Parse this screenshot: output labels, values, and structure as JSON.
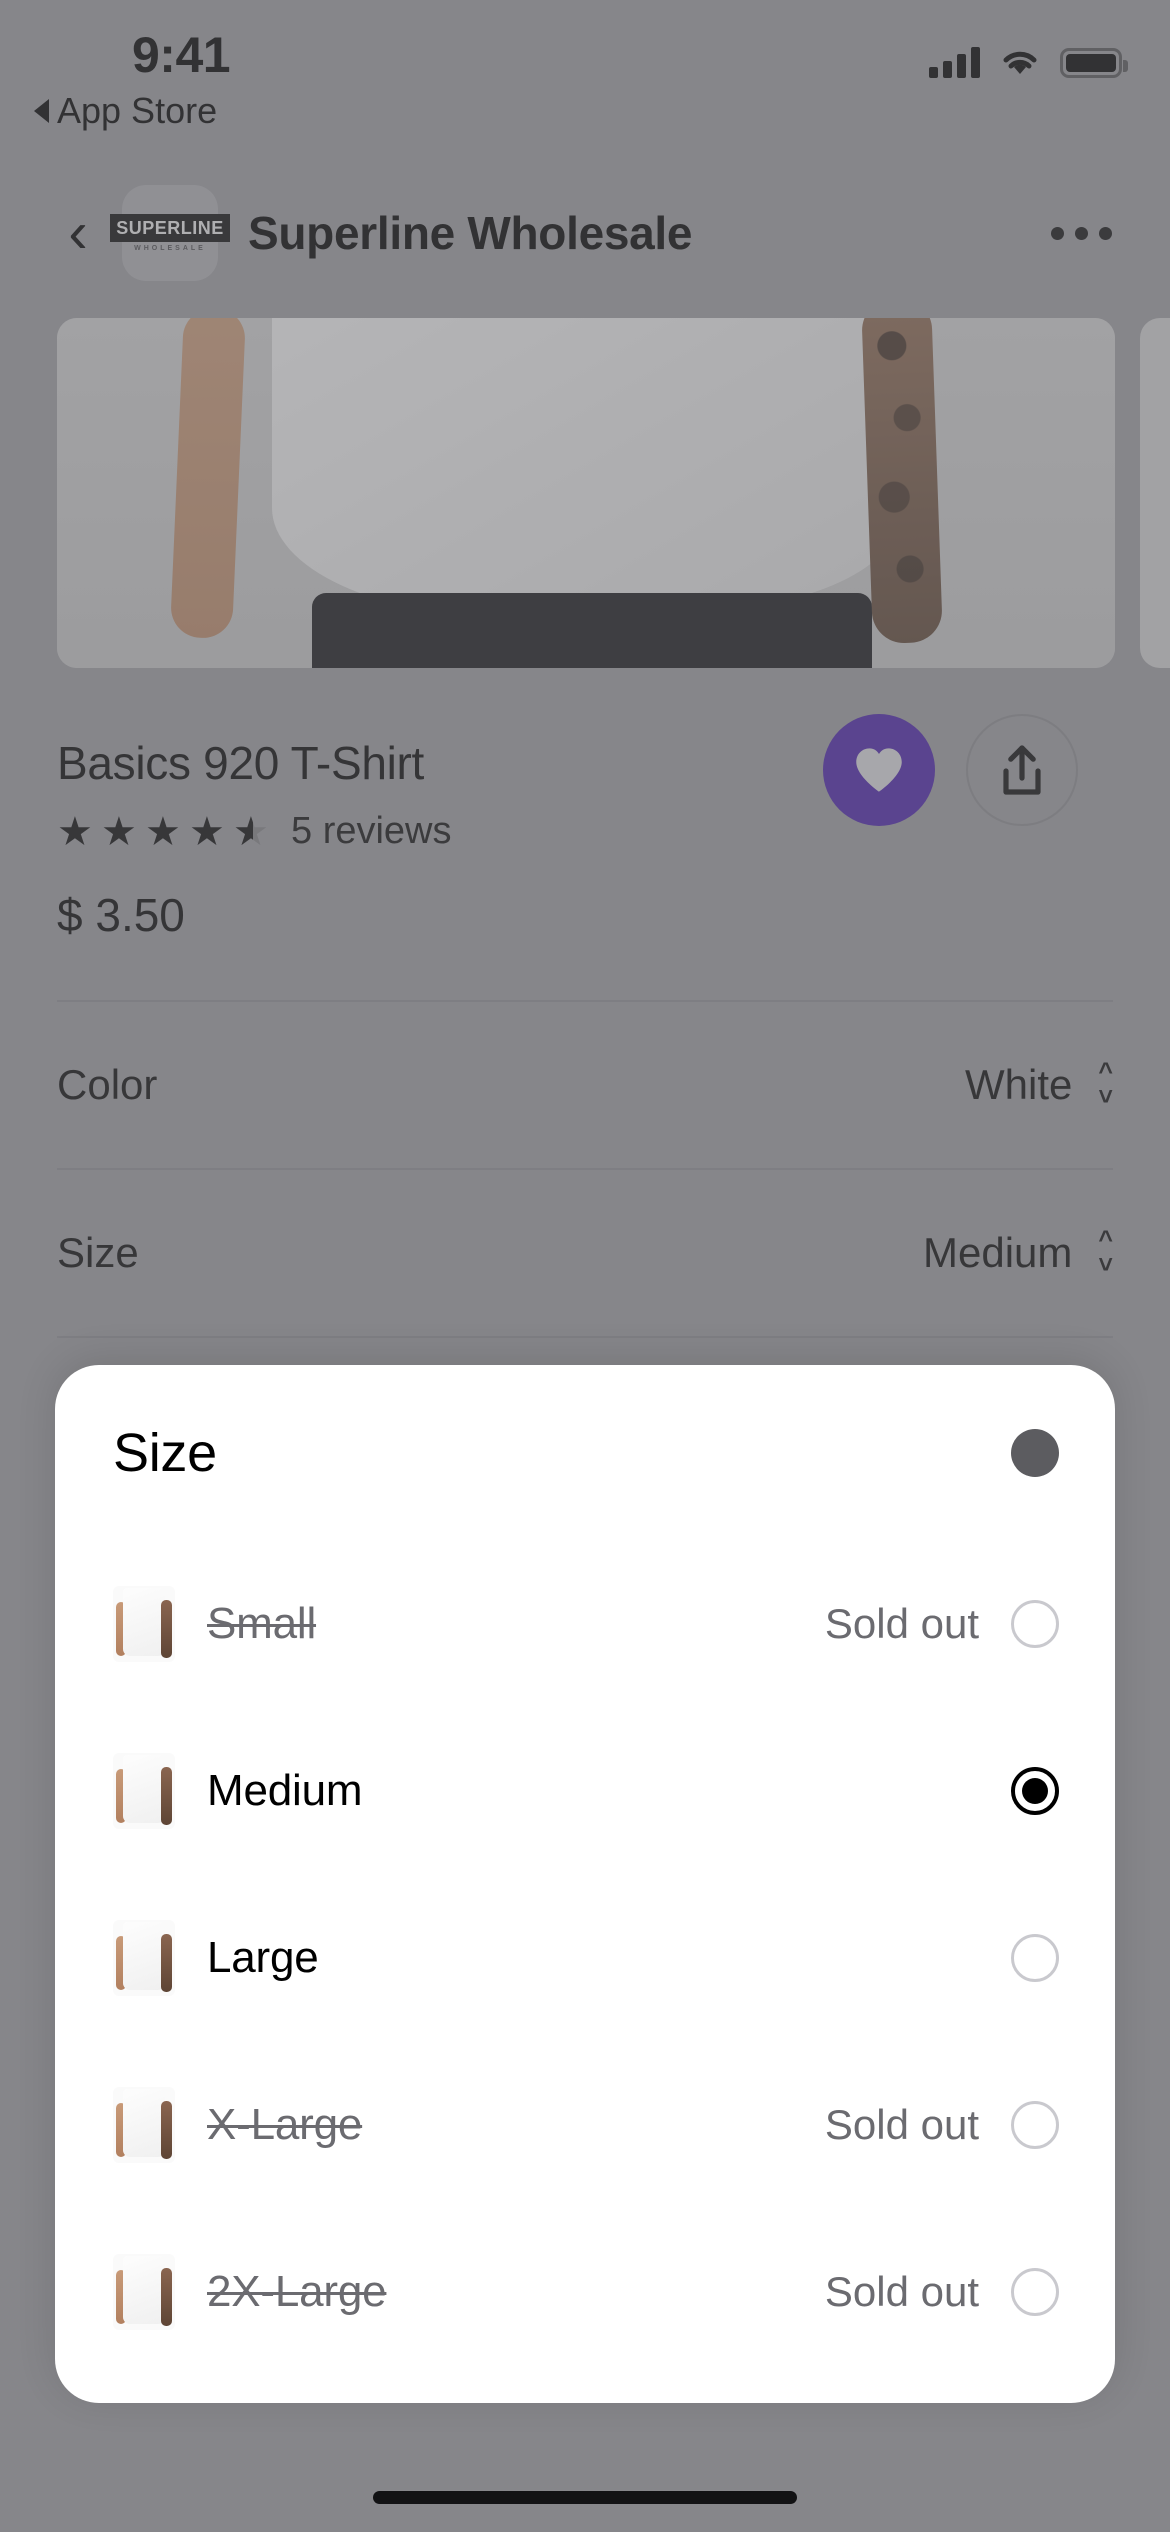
{
  "status_bar": {
    "time": "9:41",
    "back_label": "App Store",
    "cellular_icon": "cellular-signal-icon",
    "wifi_icon": "wifi-icon",
    "battery_icon": "battery-full-icon"
  },
  "nav": {
    "back_icon": "chevron-left-icon",
    "brand_mark": "SUPERLINE",
    "brand_sub": "WHOLESALE",
    "title": "Superline Wholesale",
    "more_icon": "more-horizontal-icon"
  },
  "product": {
    "title": "Basics 920 T-Shirt",
    "rating": 4.5,
    "reviews_label": "5 reviews",
    "price": "$ 3.50",
    "favorite_icon": "heart-icon",
    "favorite_active": true,
    "share_icon": "share-up-icon",
    "accent_color": "#4a22a8"
  },
  "options": [
    {
      "label": "Color",
      "value": "White",
      "stepper_icon": "chevron-up-down-icon"
    },
    {
      "label": "Size",
      "value": "Medium",
      "stepper_icon": "chevron-up-down-icon"
    }
  ],
  "sheet": {
    "title": "Size",
    "close_icon": "close-circle-icon",
    "sold_out_label": "Sold out",
    "sizes": [
      {
        "name": "Small",
        "sold_out": true,
        "selected": false,
        "thumb_icon": "tshirt-thumbnail"
      },
      {
        "name": "Medium",
        "sold_out": false,
        "selected": true,
        "thumb_icon": "tshirt-thumbnail"
      },
      {
        "name": "Large",
        "sold_out": false,
        "selected": false,
        "thumb_icon": "tshirt-thumbnail"
      },
      {
        "name": "X-Large",
        "sold_out": true,
        "selected": false,
        "thumb_icon": "tshirt-thumbnail"
      },
      {
        "name": "2X-Large",
        "sold_out": true,
        "selected": false,
        "thumb_icon": "tshirt-thumbnail"
      }
    ]
  }
}
